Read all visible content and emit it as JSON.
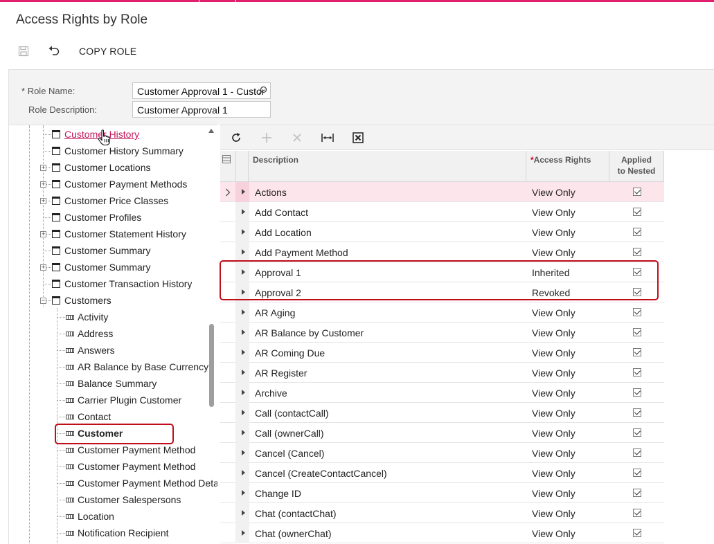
{
  "page": {
    "title": "Access Rights by Role",
    "accent_color": "#e01e6b",
    "highlight_color": "#c00d1a"
  },
  "toolbar": {
    "save_icon": "save-icon",
    "undo_icon": "undo-icon",
    "copy_role_label": "COPY ROLE"
  },
  "form": {
    "role_name_label": "Role Name:",
    "role_name_required_mark": "*",
    "role_name_value": "Customer Approval 1 - Custor",
    "role_description_label": "Role Description:",
    "role_description_value": "Customer Approval 1"
  },
  "tree": {
    "items": [
      {
        "label": "Customer History",
        "type": "page",
        "expandable": false,
        "link": true
      },
      {
        "label": "Customer History Summary",
        "type": "page",
        "expandable": false
      },
      {
        "label": "Customer Locations",
        "type": "page",
        "expandable": true
      },
      {
        "label": "Customer Payment Methods",
        "type": "page",
        "expandable": true
      },
      {
        "label": "Customer Price Classes",
        "type": "page",
        "expandable": true
      },
      {
        "label": "Customer Profiles",
        "type": "page",
        "expandable": false
      },
      {
        "label": "Customer Statement History",
        "type": "page",
        "expandable": true
      },
      {
        "label": "Customer Summary",
        "type": "page",
        "expandable": false
      },
      {
        "label": "Customer Summary",
        "type": "page",
        "expandable": true
      },
      {
        "label": "Customer Transaction History",
        "type": "page",
        "expandable": false
      },
      {
        "label": "Customers",
        "type": "page",
        "expandable": true,
        "expanded": true
      },
      {
        "label": "Activity",
        "type": "field"
      },
      {
        "label": "Address",
        "type": "field"
      },
      {
        "label": "Answers",
        "type": "field"
      },
      {
        "label": "AR Balance by Base Currency",
        "type": "field"
      },
      {
        "label": "Balance Summary",
        "type": "field"
      },
      {
        "label": "Carrier Plugin Customer",
        "type": "field"
      },
      {
        "label": "Contact",
        "type": "field"
      },
      {
        "label": "Customer",
        "type": "field",
        "bold": true,
        "highlighted": true
      },
      {
        "label": "Customer Payment Method",
        "type": "field"
      },
      {
        "label": "Customer Payment Method",
        "type": "field"
      },
      {
        "label": "Customer Payment Method Deta",
        "type": "field"
      },
      {
        "label": "Customer Salespersons",
        "type": "field"
      },
      {
        "label": "Location",
        "type": "field"
      },
      {
        "label": "Notification Recipient",
        "type": "field"
      }
    ]
  },
  "grid_toolbar": {
    "refresh_icon": "refresh-icon",
    "add_icon": "plus-icon",
    "delete_icon": "x-icon",
    "fit_icon": "fit-width-icon",
    "export_icon": "excel-export-icon"
  },
  "grid": {
    "columns": {
      "description": "Description",
      "access_rights": "Access Rights",
      "access_rights_required_mark": "*",
      "applied_to_nested_line1": "Applied",
      "applied_to_nested_line2": "to Nested"
    },
    "rows": [
      {
        "description": "Actions",
        "access": "View Only",
        "nested": true,
        "selected": true
      },
      {
        "description": "Add Contact",
        "access": "View Only",
        "nested": true
      },
      {
        "description": "Add Location",
        "access": "View Only",
        "nested": true
      },
      {
        "description": "Add Payment Method",
        "access": "View Only",
        "nested": true
      },
      {
        "description": "Approval 1",
        "access": "Inherited",
        "nested": true
      },
      {
        "description": "Approval 2",
        "access": "Revoked",
        "nested": true
      },
      {
        "description": "AR Aging",
        "access": "View Only",
        "nested": true
      },
      {
        "description": "AR Balance by Customer",
        "access": "View Only",
        "nested": true
      },
      {
        "description": "AR Coming Due",
        "access": "View Only",
        "nested": true
      },
      {
        "description": "AR Register",
        "access": "View Only",
        "nested": true
      },
      {
        "description": "Archive",
        "access": "View Only",
        "nested": true
      },
      {
        "description": "Call (contactCall)",
        "access": "View Only",
        "nested": true
      },
      {
        "description": "Call (ownerCall)",
        "access": "View Only",
        "nested": true
      },
      {
        "description": "Cancel (Cancel)",
        "access": "View Only",
        "nested": true
      },
      {
        "description": "Cancel (CreateContactCancel)",
        "access": "View Only",
        "nested": true
      },
      {
        "description": "Change ID",
        "access": "View Only",
        "nested": true
      },
      {
        "description": "Chat (contactChat)",
        "access": "View Only",
        "nested": true
      },
      {
        "description": "Chat (ownerChat)",
        "access": "View Only",
        "nested": true
      }
    ]
  }
}
